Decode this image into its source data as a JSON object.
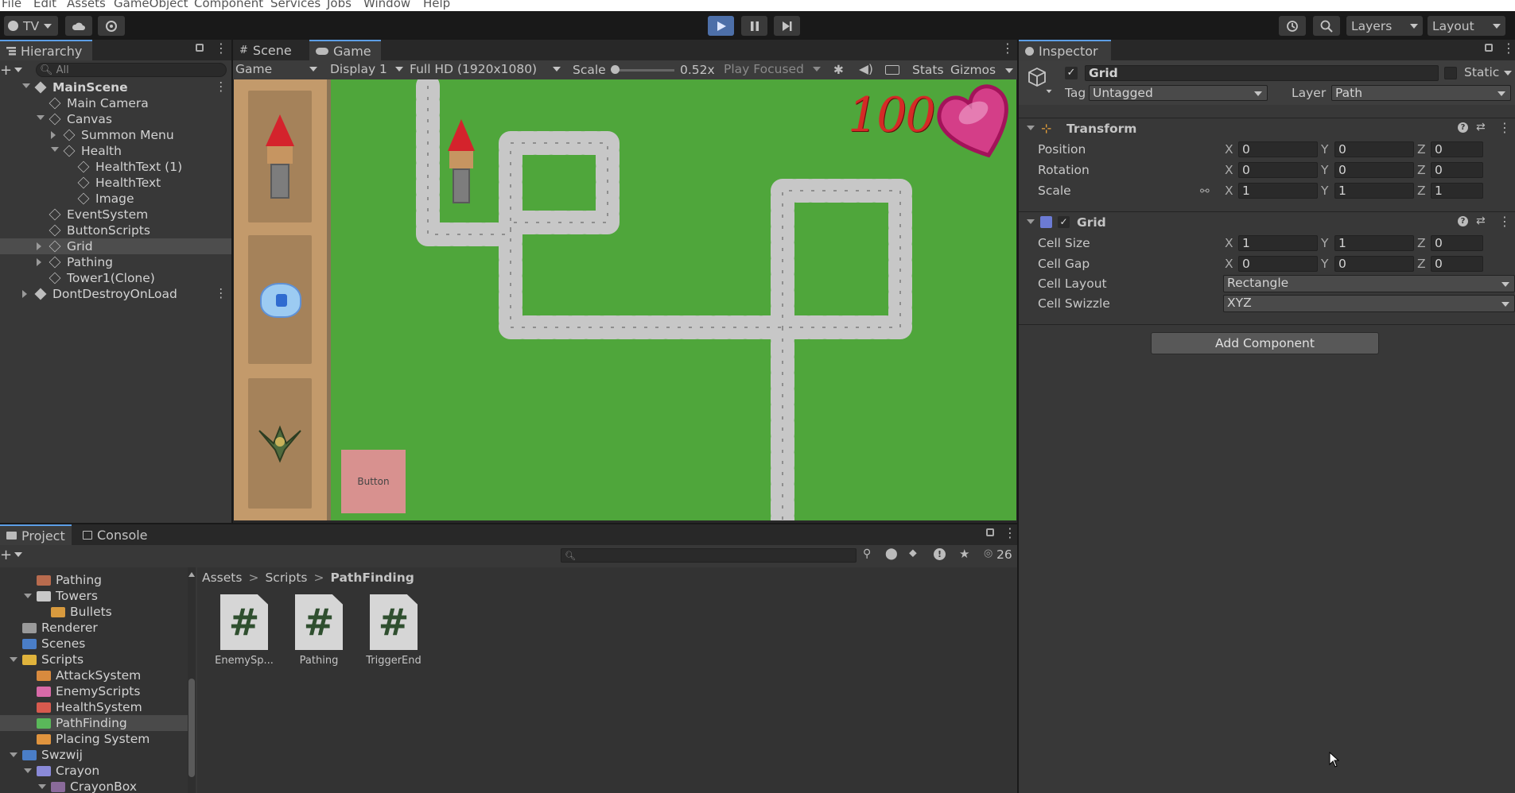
{
  "menu": [
    "File",
    "Edit",
    "Assets",
    "GameObject",
    "Component",
    "Services",
    "Jobs",
    "Window",
    "Help"
  ],
  "toolbar": {
    "account": "TV",
    "layers": "Layers",
    "layout": "Layout"
  },
  "hierarchy": {
    "tab": "Hierarchy",
    "search_placeholder": "All",
    "items": [
      {
        "label": "MainScene",
        "depth": 0,
        "arrow": "down",
        "bold": true
      },
      {
        "label": "Main Camera",
        "depth": 1,
        "arrow": ""
      },
      {
        "label": "Canvas",
        "depth": 1,
        "arrow": "down"
      },
      {
        "label": "Summon Menu",
        "depth": 2,
        "arrow": "right"
      },
      {
        "label": "Health",
        "depth": 2,
        "arrow": "down"
      },
      {
        "label": "HealthText (1)",
        "depth": 3,
        "arrow": ""
      },
      {
        "label": "HealthText",
        "depth": 3,
        "arrow": ""
      },
      {
        "label": "Image",
        "depth": 3,
        "arrow": ""
      },
      {
        "label": "EventSystem",
        "depth": 1,
        "arrow": ""
      },
      {
        "label": "ButtonScripts",
        "depth": 1,
        "arrow": ""
      },
      {
        "label": "Grid",
        "depth": 1,
        "arrow": "right",
        "selected": true
      },
      {
        "label": "Pathing",
        "depth": 1,
        "arrow": "right"
      },
      {
        "label": "Tower1(Clone)",
        "depth": 1,
        "arrow": ""
      },
      {
        "label": "DontDestroyOnLoad",
        "depth": 0,
        "arrow": "right"
      }
    ]
  },
  "game": {
    "tabs": [
      "Scene",
      "Game"
    ],
    "mode": "Game",
    "display": "Display 1",
    "resolution": "Full HD (1920x1080)",
    "scale_label": "Scale",
    "scale_value": "0.52x",
    "play_focused": "Play Focused",
    "stats": "Stats",
    "gizmos": "Gizmos",
    "health_value": "100",
    "button_label": "Button"
  },
  "inspector": {
    "tab": "Inspector",
    "object_name": "Grid",
    "static_label": "Static",
    "tag_label": "Tag",
    "tag_value": "Untagged",
    "layer_label": "Layer",
    "layer_value": "Path",
    "transform": {
      "title": "Transform",
      "rows": [
        {
          "label": "Position",
          "x": "0",
          "y": "0",
          "z": "0"
        },
        {
          "label": "Rotation",
          "x": "0",
          "y": "0",
          "z": "0"
        },
        {
          "label": "Scale",
          "x": "1",
          "y": "1",
          "z": "1"
        }
      ]
    },
    "grid": {
      "title": "Grid",
      "rows": [
        {
          "label": "Cell Size",
          "x": "1",
          "y": "1",
          "z": "0"
        },
        {
          "label": "Cell Gap",
          "x": "0",
          "y": "0",
          "z": "0"
        }
      ],
      "cell_layout_label": "Cell Layout",
      "cell_layout_value": "Rectangle",
      "cell_swizzle_label": "Cell Swizzle",
      "cell_swizzle_value": "XYZ"
    },
    "add_component": "Add Component",
    "axes": {
      "x": "X",
      "y": "Y",
      "z": "Z"
    }
  },
  "project": {
    "tabs": [
      "Project",
      "Console"
    ],
    "badge_count": "26",
    "breadcrumb": [
      "Assets",
      "Scripts",
      "PathFinding"
    ],
    "tree": [
      {
        "label": "Pathing",
        "depth": 2,
        "color": "#b86b4e",
        "arrow": ""
      },
      {
        "label": "Towers",
        "depth": 2,
        "color": "#c8c8c8",
        "arrow": "down"
      },
      {
        "label": "Bullets",
        "depth": 3,
        "color": "#d89a3e",
        "arrow": ""
      },
      {
        "label": "Renderer",
        "depth": 1,
        "color": "#9a9a9a",
        "arrow": ""
      },
      {
        "label": "Scenes",
        "depth": 1,
        "color": "#4a7ec8",
        "arrow": ""
      },
      {
        "label": "Scripts",
        "depth": 1,
        "color": "#e0b33c",
        "arrow": "down"
      },
      {
        "label": "AttackSystem",
        "depth": 2,
        "color": "#d88a3e",
        "arrow": ""
      },
      {
        "label": "EnemyScripts",
        "depth": 2,
        "color": "#d86aa8",
        "arrow": ""
      },
      {
        "label": "HealthSystem",
        "depth": 2,
        "color": "#d85a4e",
        "arrow": ""
      },
      {
        "label": "PathFinding",
        "depth": 2,
        "color": "#5ab85a",
        "arrow": "",
        "selected": true
      },
      {
        "label": "Placing System",
        "depth": 2,
        "color": "#e0943e",
        "arrow": ""
      },
      {
        "label": "Swzwij",
        "depth": 1,
        "color": "#4a7ec8",
        "arrow": "down"
      },
      {
        "label": "Crayon",
        "depth": 2,
        "color": "#8a8ad8",
        "arrow": "down"
      },
      {
        "label": "CrayonBox",
        "depth": 3,
        "color": "#8a6a9a",
        "arrow": "down"
      }
    ],
    "files": [
      "EnemySp...",
      "Pathing",
      "TriggerEnd"
    ]
  }
}
